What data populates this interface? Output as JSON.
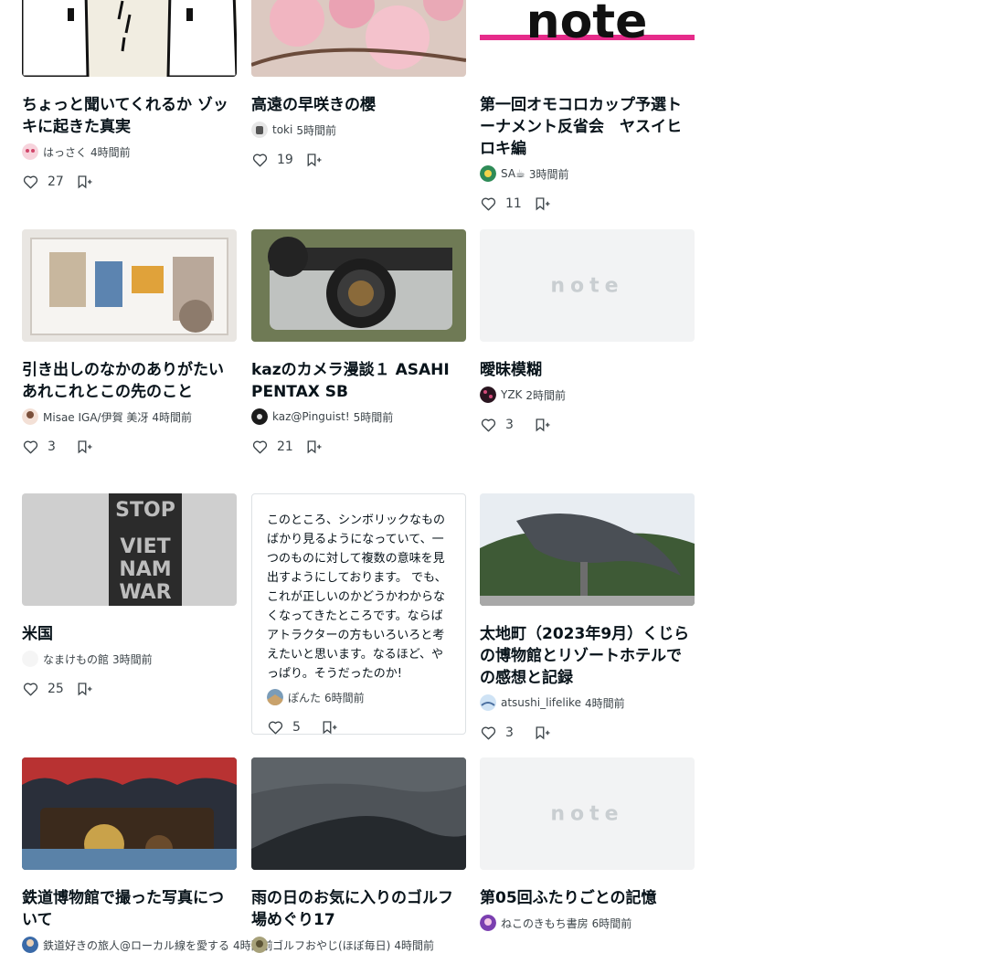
{
  "cards": [
    {
      "title": "ちょっと聞いてくれるか ゾッキに起きた真実",
      "author": "はっさく",
      "time": "4時間前",
      "likes": "27"
    },
    {
      "title": "高遠の早咲きの櫻",
      "author": "toki",
      "time": "5時間前",
      "likes": "19"
    },
    {
      "title": "第一回オモコロカップ予選トーナメント反省会　ヤスイヒロキ編",
      "author": "SA☕",
      "time": "3時間前",
      "likes": "11",
      "logo_text": "note"
    },
    {
      "title": "引き出しのなかのありがたいあれこれとこの先のこと",
      "author": "Misae IGA/伊賀 美冴",
      "time": "4時間前",
      "likes": "3"
    },
    {
      "title": "kazのカメラ漫談１ ASAHI PENTAX SB",
      "author": "kaz@Pinguist!",
      "time": "5時間前",
      "likes": "21"
    },
    {
      "title": "曖昧模糊",
      "author": "YZK",
      "time": "2時間前",
      "likes": "3",
      "placeholder_logo": "note"
    },
    {
      "title": "米国",
      "author": "なまけもの館",
      "time": "3時間前",
      "likes": "25"
    },
    {
      "excerpt": "このところ、シンボリックなものばかり見るようになっていて、一つのものに対して複数の意味を見出すようにしております。 でも、これが正しいのかどうかわからなくなってきたところです。ならばアトラクターの方もいろいろと考えたいと思います。なるほど、やっぱり。そうだったのか!",
      "author": "ぽんた",
      "time": "6時間前",
      "likes": "5"
    },
    {
      "title": "太地町（2023年9月）くじらの博物館とリゾートホテルでの感想と記録",
      "author": "atsushi_lifelike",
      "time": "4時間前",
      "likes": "3"
    },
    {
      "title": "鉄道博物館で撮った写真について",
      "author": "鉄道好きの旅人@ローカル線を愛する",
      "time": "4時間前",
      "likes": ""
    },
    {
      "title": "雨の日のお気に入りのゴルフ場めぐり17",
      "author": "ゴルフおやじ(ほぼ毎日)",
      "time": "4時間前",
      "likes": ""
    },
    {
      "title": "第05回ふたりごとの記憶",
      "author": "ねこのきもち書房",
      "time": "6時間前",
      "likes": "",
      "placeholder_logo": "note"
    }
  ],
  "colors": {
    "text": "#08131a",
    "meta": "#3c4449",
    "border": "#dde1e4",
    "placeholder_bg": "#f2f3f4",
    "note_pink": "#e62b8a"
  },
  "icons": {
    "like": "heart-outline-icon",
    "save": "bookmark-add-icon"
  }
}
